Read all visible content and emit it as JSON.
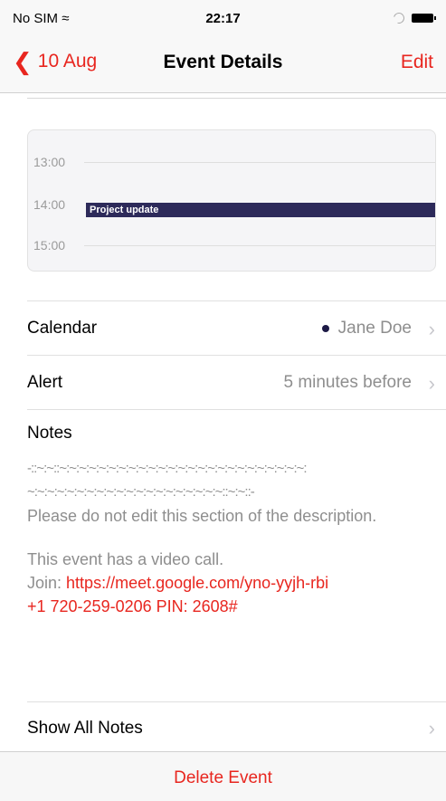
{
  "status_bar": {
    "carrier": "No SIM",
    "wifi_icon": "wifi-icon",
    "time": "22:17"
  },
  "nav": {
    "back_label": "10 Aug",
    "title": "Event Details",
    "edit_label": "Edit"
  },
  "mini_calendar": {
    "hours": [
      "13:00",
      "14:00",
      "15:00"
    ],
    "event_title": "Project update",
    "event_color": "#2d2a5a"
  },
  "rows": {
    "calendar": {
      "label": "Calendar",
      "value": "Jane Doe"
    },
    "alert": {
      "label": "Alert",
      "value": "5 minutes before"
    }
  },
  "notes": {
    "title": "Notes",
    "line1": "-::~:~::~:~:~:~:~:~:~:~:~:~:~:~:~:~:~:~:~:~:~:~:~:~:~:~:~:",
    "line2": "~:~:~:~:~:~:~:~:~:~:~:~:~:~:~:~:~:~:~:~::~:~::-",
    "warning": "Please do not edit this section of the description.",
    "video_text": "This event has a video call.",
    "join_label": "Join:",
    "join_link": "https://meet.google.com/yno-yyjh-rbi",
    "phone": "+1 720-259-0206 PIN: 2608#"
  },
  "show_all_notes_label": "Show All Notes",
  "delete_label": "Delete Event",
  "colors": {
    "accent": "#e8261f",
    "secondary_text": "#8e8e8e"
  }
}
